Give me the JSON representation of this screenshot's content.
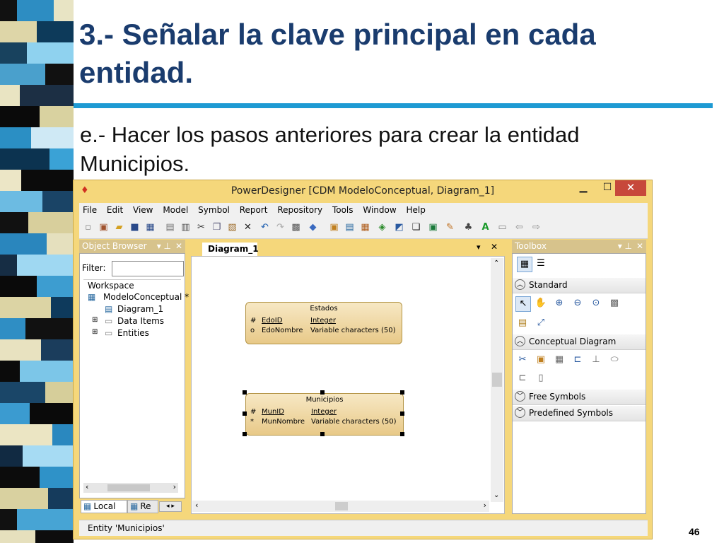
{
  "slide": {
    "title": "3.- Señalar la clave principal en cada entidad.",
    "body": "e.- Hacer los pasos anteriores para crear la entidad Municipios.",
    "page_number": "46"
  },
  "colors": {
    "title": "#1a3c6e",
    "rule": "#1e9ad3",
    "window_frame": "#f5d77b",
    "close_button": "#c7483b",
    "entity_fill": "#f0d9a4"
  },
  "window": {
    "title": "PowerDesigner [CDM ModeloConceptual, Diagram_1]",
    "menu": [
      {
        "label": "File"
      },
      {
        "label": "Edit"
      },
      {
        "label": "View"
      },
      {
        "label": "Model"
      },
      {
        "label": "Symbol"
      },
      {
        "label": "Report"
      },
      {
        "label": "Repository"
      },
      {
        "label": "Tools"
      },
      {
        "label": "Window"
      },
      {
        "label": "Help"
      }
    ],
    "toolbar_icons": [
      "new-icon",
      "open-model-icon",
      "open-icon",
      "save-icon",
      "save-all-icon",
      "print-preview-icon",
      "print-icon",
      "cut-icon",
      "copy-icon",
      "paste-icon",
      "delete-icon",
      "undo-icon",
      "redo-icon",
      "properties-icon",
      "check-model-icon",
      "database-icon",
      "generate-icon",
      "diagram-icon",
      "refresh-icon",
      "edit-icon",
      "window-icon",
      "export-icon",
      "pencil-icon",
      "paint-icon",
      "text-A-icon",
      "image-icon",
      "back-icon",
      "forward-icon"
    ]
  },
  "object_browser": {
    "header": "Object Browser",
    "filter_label": "Filter:",
    "filter_value": "",
    "tree": {
      "workspace": "Workspace",
      "model": "ModeloConceptual *",
      "diagram": "Diagram_1",
      "data_items": "Data Items",
      "entities": "Entities"
    },
    "tabs": {
      "local": "Local",
      "repository": "Re"
    }
  },
  "diagram": {
    "tab": "Diagram_1",
    "entities": [
      {
        "name": "Estados",
        "columns": [
          {
            "marker": "#",
            "name": "EdoID",
            "type": "Integer",
            "pk": true
          },
          {
            "marker": "o",
            "name": "EdoNombre",
            "type": "Variable characters (50)",
            "pk": false
          }
        ]
      },
      {
        "name": "Municipios",
        "columns": [
          {
            "marker": "#",
            "name": "MunID",
            "type": "Integer",
            "pk": true
          },
          {
            "marker": "*",
            "name": "MunNombre",
            "type": "Variable characters (50)",
            "pk": false
          }
        ]
      }
    ]
  },
  "toolbox": {
    "header": "Toolbox",
    "sections": {
      "standard": "Standard",
      "conceptual": "Conceptual Diagram",
      "free": "Free Symbols",
      "predefined": "Predefined Symbols"
    }
  },
  "status_bar": {
    "text": "Entity 'Municipios'"
  }
}
